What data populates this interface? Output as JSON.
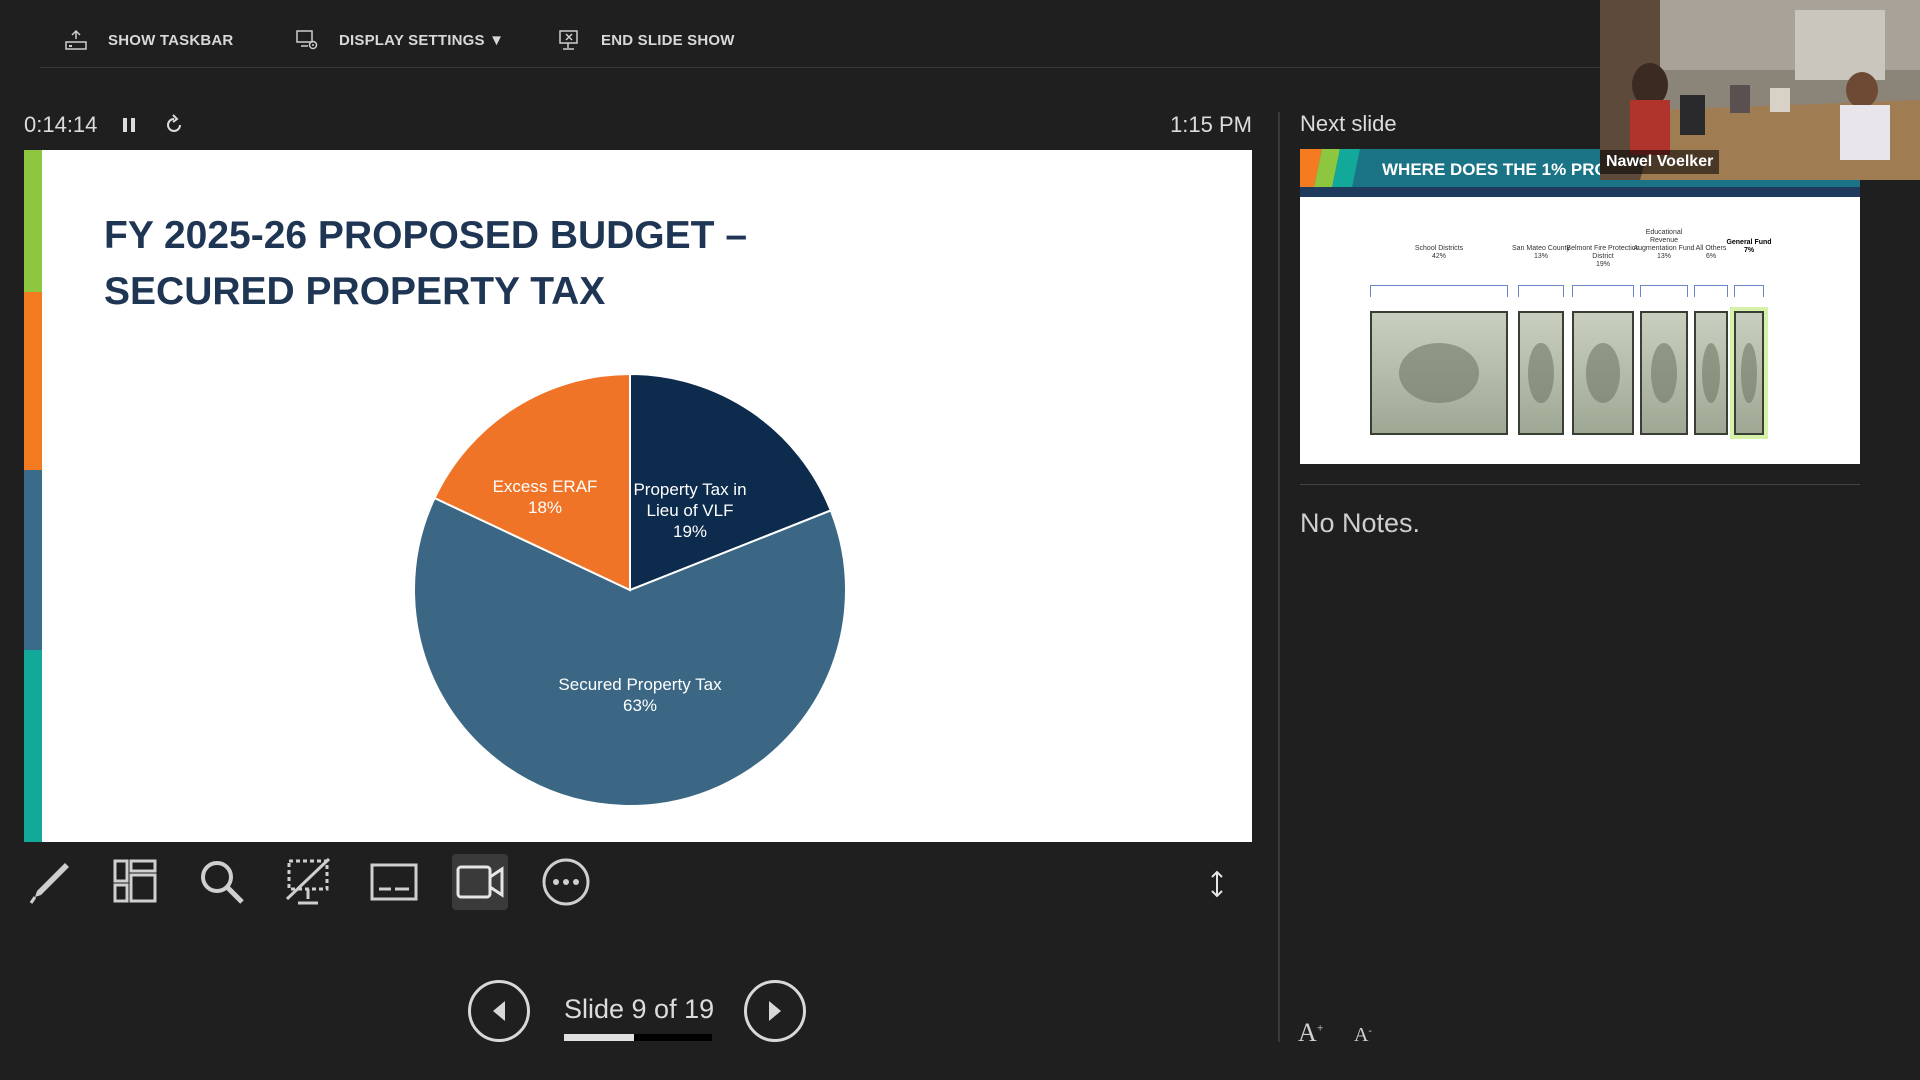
{
  "toolbar": {
    "show_taskbar": "SHOW TASKBAR",
    "display_settings": "DISPLAY SETTINGS ▼",
    "end_slide_show": "END SLIDE SHOW"
  },
  "timer": {
    "elapsed": "0:14:14",
    "clock": "1:15 PM"
  },
  "slide": {
    "title_line1": "FY 2025-26 PROPOSED BUDGET –",
    "title_line2": "SECURED PROPERTY TAX",
    "stripe_colors": [
      "#8dc63f",
      "#f47b20",
      "#3a6b8a",
      "#12a89a"
    ]
  },
  "chart_data": {
    "type": "pie",
    "slices": [
      {
        "label": "Property Tax in Lieu of VLF",
        "value": 19,
        "text": "19%",
        "color": "#0d2b4d"
      },
      {
        "label": "Secured Property Tax",
        "value": 63,
        "text": "63%",
        "color": "#3b6784"
      },
      {
        "label": "Excess ERAF",
        "value": 18,
        "text": "18%",
        "color": "#f07427"
      }
    ]
  },
  "tools": {
    "pen": "pen-tool",
    "see_all": "see-all-slides",
    "zoom": "zoom",
    "black_screen": "black-screen",
    "subtitles": "subtitles",
    "camera": "camera",
    "more": "more-options"
  },
  "nav": {
    "counter": "Slide 9 of 19",
    "current": 9,
    "total": 19,
    "progress": 0.47
  },
  "next_slide": {
    "label": "Next slide",
    "banner_title": "WHERE DOES THE 1% PRO",
    "groups": [
      {
        "name": "School Districts",
        "pct": "42%"
      },
      {
        "name": "San Mateo County",
        "pct": "13%"
      },
      {
        "name": "Belmont Fire Protection District",
        "pct": "19%"
      },
      {
        "name": "Educational Revenue Augmentation Fund",
        "pct": "13%"
      },
      {
        "name": "All Others",
        "pct": "6%"
      },
      {
        "name": "General Fund",
        "pct": "7%"
      }
    ]
  },
  "notes": {
    "text": "No Notes."
  },
  "video": {
    "participant": "Nawel Voelker"
  }
}
